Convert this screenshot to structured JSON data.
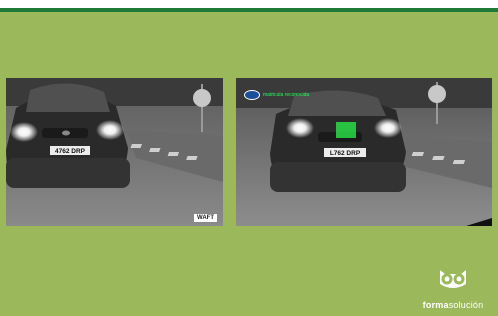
{
  "plates": {
    "left": "4762 DRP",
    "right": "L762 DRP"
  },
  "watermark": "WAFT",
  "ocr": {
    "overlay_text": "matricula reconocida"
  },
  "brand": {
    "name_bold": "forma",
    "name_light": "solución"
  },
  "colors": {
    "background": "#9bb85a",
    "top_accent": "#1f7a3a",
    "ocr_highlight": "#28dc46"
  }
}
